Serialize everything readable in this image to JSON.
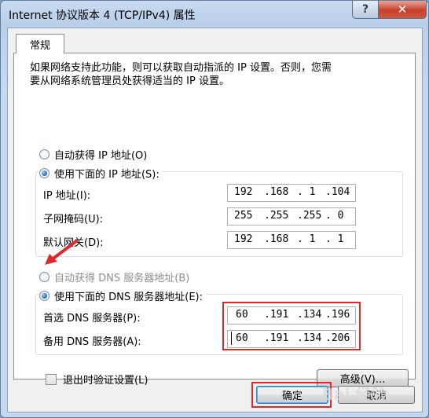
{
  "window": {
    "title": "Internet 协议版本 4 (TCP/IPv4) 属性",
    "help_label": "?",
    "close_label": "✕"
  },
  "tab": {
    "label": "常规"
  },
  "description": "如果网络支持此功能，则可以获取自动指派的 IP 设置。否则，您需\n要从网络系统管理员处获得适当的 IP 设置。",
  "ip_section": {
    "auto_label": "自动获得 IP 地址(O)",
    "manual_label": "使用下面的 IP 地址(S):",
    "selected": "manual",
    "fields": [
      {
        "label": "IP 地址(I):",
        "octets": [
          "192",
          ".168",
          ". 1",
          ".104"
        ]
      },
      {
        "label": "子网掩码(U):",
        "octets": [
          "255",
          ".255",
          ".255",
          ". 0"
        ]
      },
      {
        "label": "默认网关(D):",
        "octets": [
          "192",
          ".168",
          ". 1",
          ". 1"
        ]
      }
    ]
  },
  "dns_section": {
    "auto_label": "自动获得 DNS 服务器地址(B)",
    "manual_label": "使用下面的 DNS 服务器地址(E):",
    "selected": "manual",
    "fields": [
      {
        "label": "首选 DNS 服务器(P):",
        "octets": [
          "60",
          ".191",
          ".134",
          ".196"
        ]
      },
      {
        "label": "备用 DNS 服务器(A):",
        "octets": [
          "60",
          ".191",
          ".134",
          ".206"
        ]
      }
    ]
  },
  "validate_on_exit": {
    "label": "退出时验证设置(L)",
    "checked": false
  },
  "buttons": {
    "advanced": "高级(V)...",
    "ok": "确定",
    "cancel": "取消"
  },
  "colors": {
    "highlight": "#e0282c",
    "accent": "#1a5fb4"
  },
  "watermark": "Bai 经验"
}
